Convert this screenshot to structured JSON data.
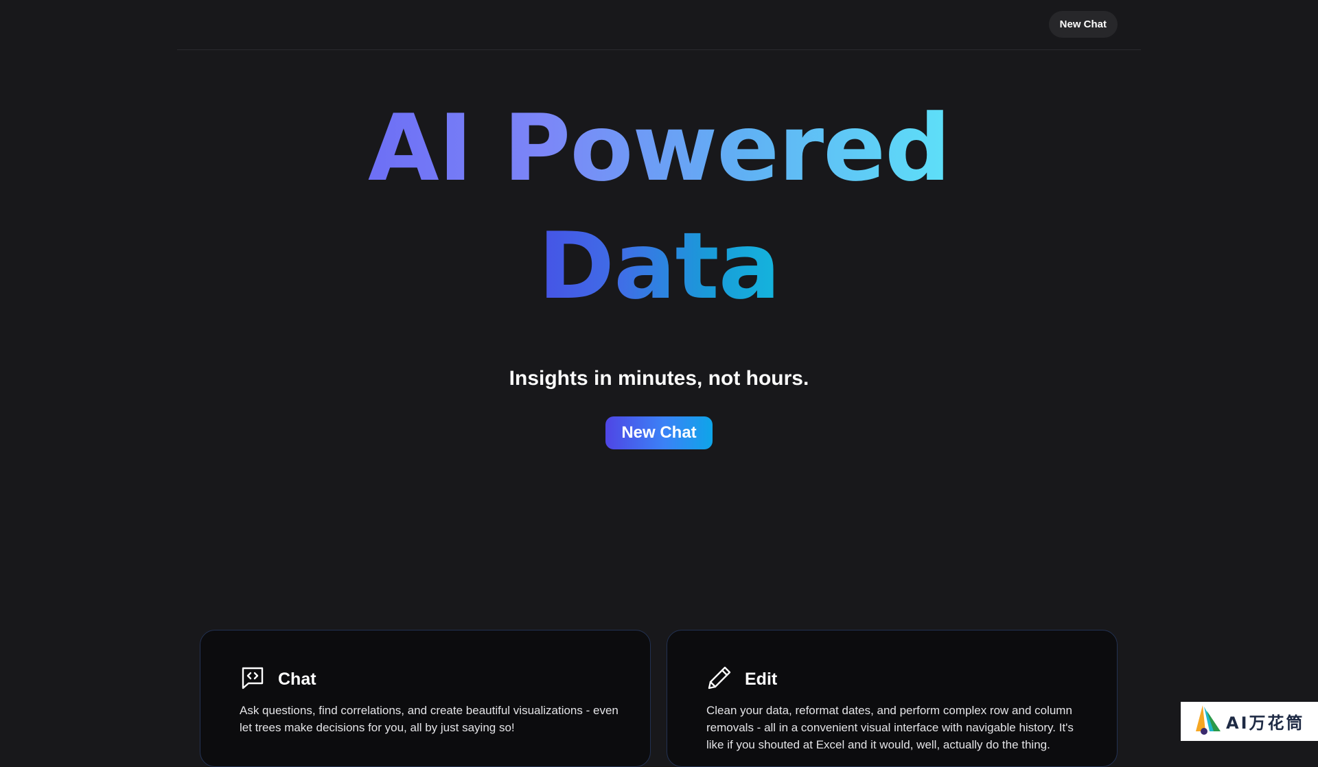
{
  "header": {
    "new_chat_label": "New Chat"
  },
  "hero": {
    "title_line1": "AI Powered",
    "title_line2": "Data",
    "subtitle": "Insights in minutes, not hours.",
    "cta_label": "New Chat"
  },
  "features": [
    {
      "icon": "chat-bubble-code-icon",
      "title": "Chat",
      "description": "Ask questions, find correlations, and create beautiful visualizations - even let trees make decisions for you, all by just saying so!"
    },
    {
      "icon": "pencil-icon",
      "title": "Edit",
      "description": "Clean your data, reformat dates, and perform complex row and column removals - all in a convenient visual interface with navigable history. It's like if you shouted at Excel and it would, well, actually do the thing."
    }
  ],
  "watermark": {
    "text": "AI万花筒",
    "icon": "colorful-sail-logo-icon"
  },
  "colors": {
    "background": "#18181b",
    "card_border": "#233253",
    "accent_indigo": "#4f46e5",
    "accent_cyan": "#0ea5e9"
  }
}
